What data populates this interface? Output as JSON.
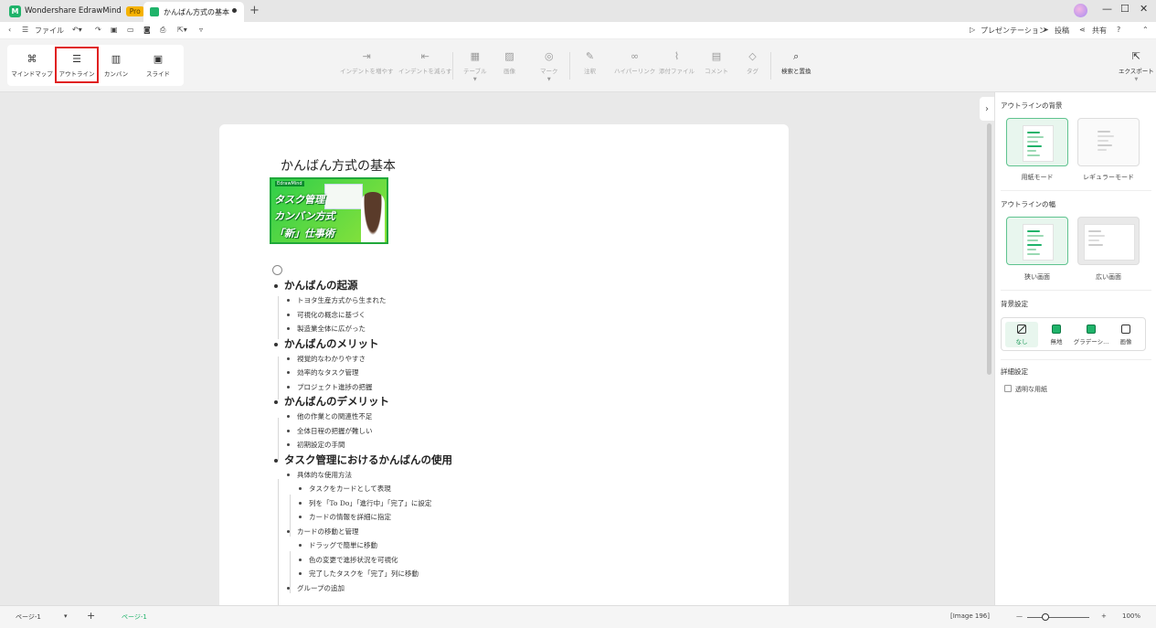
{
  "app": {
    "name": "Wondershare EdrawMind",
    "badge": "Pro"
  },
  "tab": {
    "title": "かんばん方式の基本",
    "new_tab": "+"
  },
  "window": {
    "minimize": "—",
    "maximize": "☐",
    "close": "✕"
  },
  "menu": {
    "file": "ファイル",
    "presentation": "プレゼンテーション",
    "publish": "投稿",
    "share": "共有",
    "help": "?"
  },
  "views": [
    {
      "label": "マインドマップ",
      "icon": "⌘"
    },
    {
      "label": "アウトライン",
      "icon": "☰"
    },
    {
      "label": "カンバン",
      "icon": "▥"
    },
    {
      "label": "スライド",
      "icon": "▣"
    }
  ],
  "tools": {
    "indent_in": "インデントを増やす",
    "indent_out": "インデントを減らす",
    "table": "テーブル",
    "image": "画像",
    "mark": "マーク",
    "note": "注釈",
    "hyperlink": "ハイパーリンク",
    "attachment": "添付ファイル",
    "comment": "コメント",
    "tag": "タグ",
    "find_replace": "検索と置換",
    "export": "エクスポート"
  },
  "document": {
    "title": "かんばん方式の基本",
    "banner": {
      "brand": "EdrawMind",
      "line1": "タスク管理",
      "line2": "カンバン方式",
      "line3": "「新」仕事術"
    },
    "outline": [
      {
        "text": "かんばんの起源",
        "children": [
          {
            "text": "トヨタ生産方式から生まれた"
          },
          {
            "text": "可視化の概念に基づく"
          },
          {
            "text": "製造業全体に広がった"
          }
        ]
      },
      {
        "text": "かんばんのメリット",
        "children": [
          {
            "text": "視覚的なわかりやすさ"
          },
          {
            "text": "効率的なタスク管理"
          },
          {
            "text": "プロジェクト進捗の把握"
          }
        ]
      },
      {
        "text": "かんばんのデメリット",
        "children": [
          {
            "text": "他の作業との関連性不足"
          },
          {
            "text": "全体日程の把握が難しい"
          },
          {
            "text": "初期設定の手間"
          }
        ]
      },
      {
        "text": "タスク管理におけるかんばんの使用",
        "children": [
          {
            "text": "具体的な使用方法",
            "children": [
              {
                "text": "タスクをカードとして表現"
              },
              {
                "text": "列を「To Do」「進行中」「完了」に設定"
              },
              {
                "text": "カードの情報を詳細に指定"
              }
            ]
          },
          {
            "text": "カードの移動と管理",
            "children": [
              {
                "text": "ドラッグで簡単に移動"
              },
              {
                "text": "色の変更で進捗状況を可視化"
              },
              {
                "text": "完了したタスクを「完了」列に移動"
              }
            ]
          },
          {
            "text": "グループの追加"
          }
        ]
      }
    ]
  },
  "panel": {
    "background_title": "アウトラインの背景",
    "bg_modes": [
      "用紙モード",
      "レギュラーモード"
    ],
    "width_title": "アウトラインの幅",
    "widths": [
      "狭い画面",
      "広い画面"
    ],
    "bg_settings_title": "背景設定",
    "bg_options": [
      "なし",
      "無地",
      "グラデーシ...",
      "画像"
    ],
    "detail_title": "詳細設定",
    "transparent_label": "透明な用紙"
  },
  "status": {
    "page_select": "ページ-1",
    "add_page": "+",
    "page_tab": "ページ-1",
    "image_info": "[Image 196]",
    "zoom_minus": "—",
    "zoom_plus": "+",
    "zoom": "100%"
  },
  "colors": {
    "accent": "#1fb36a",
    "highlight": "#e02020"
  }
}
